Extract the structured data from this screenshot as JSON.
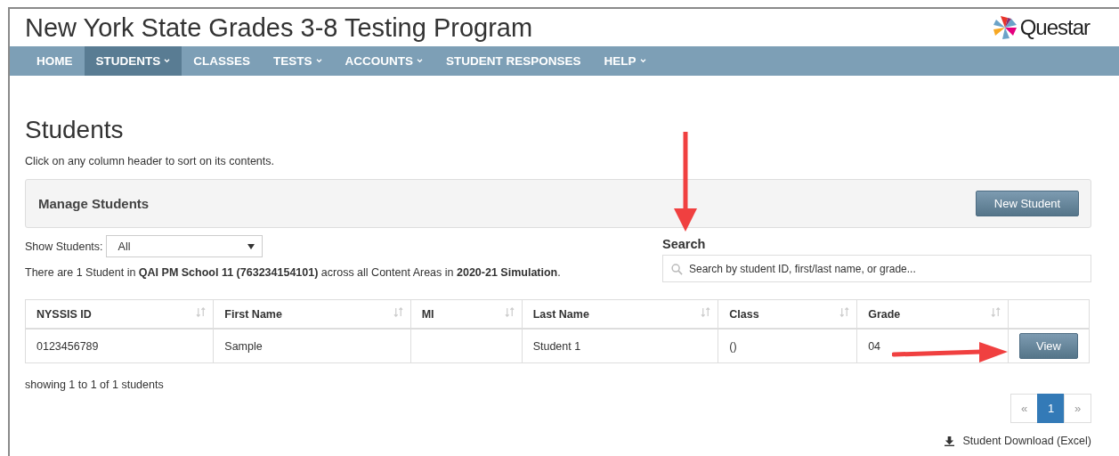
{
  "header": {
    "title": "New York State Grades 3-8 Testing Program",
    "logo_text": "Questar"
  },
  "nav": [
    {
      "label": "HOME",
      "selected": false,
      "dropdown": false
    },
    {
      "label": "STUDENTS",
      "selected": true,
      "dropdown": true
    },
    {
      "label": "CLASSES",
      "selected": false,
      "dropdown": false
    },
    {
      "label": "TESTS",
      "selected": false,
      "dropdown": true
    },
    {
      "label": "ACCOUNTS",
      "selected": false,
      "dropdown": true
    },
    {
      "label": "STUDENT RESPONSES",
      "selected": false,
      "dropdown": false
    },
    {
      "label": "HELP",
      "selected": false,
      "dropdown": true
    }
  ],
  "page": {
    "heading": "Students",
    "subtitle": "Click on any column header to sort on its contents."
  },
  "panel": {
    "title": "Manage Students",
    "button": "New Student"
  },
  "filter": {
    "label": "Show Students:",
    "value": "All"
  },
  "summary": "There are 1 Student in **QAI PM School 11 (763234154101)** across all Content Areas in **2020-21 Simulation**.",
  "search": {
    "label": "Search",
    "placeholder": "Search by student ID, first/last name, or grade..."
  },
  "table": {
    "columns": [
      "NYSSIS ID",
      "First Name",
      "MI",
      "Last Name",
      "Class",
      "Grade"
    ],
    "rows": [
      {
        "cells": [
          "0123456789",
          "Sample",
          "",
          "Student 1",
          "()",
          "04"
        ],
        "action": "View"
      }
    ]
  },
  "showing": "showing 1 to 1 of 1 students",
  "pagination": [
    {
      "label": "«",
      "selected": false
    },
    {
      "label": "1",
      "selected": true
    },
    {
      "label": "»",
      "selected": false
    }
  ],
  "download": "Student Download (Excel)"
}
